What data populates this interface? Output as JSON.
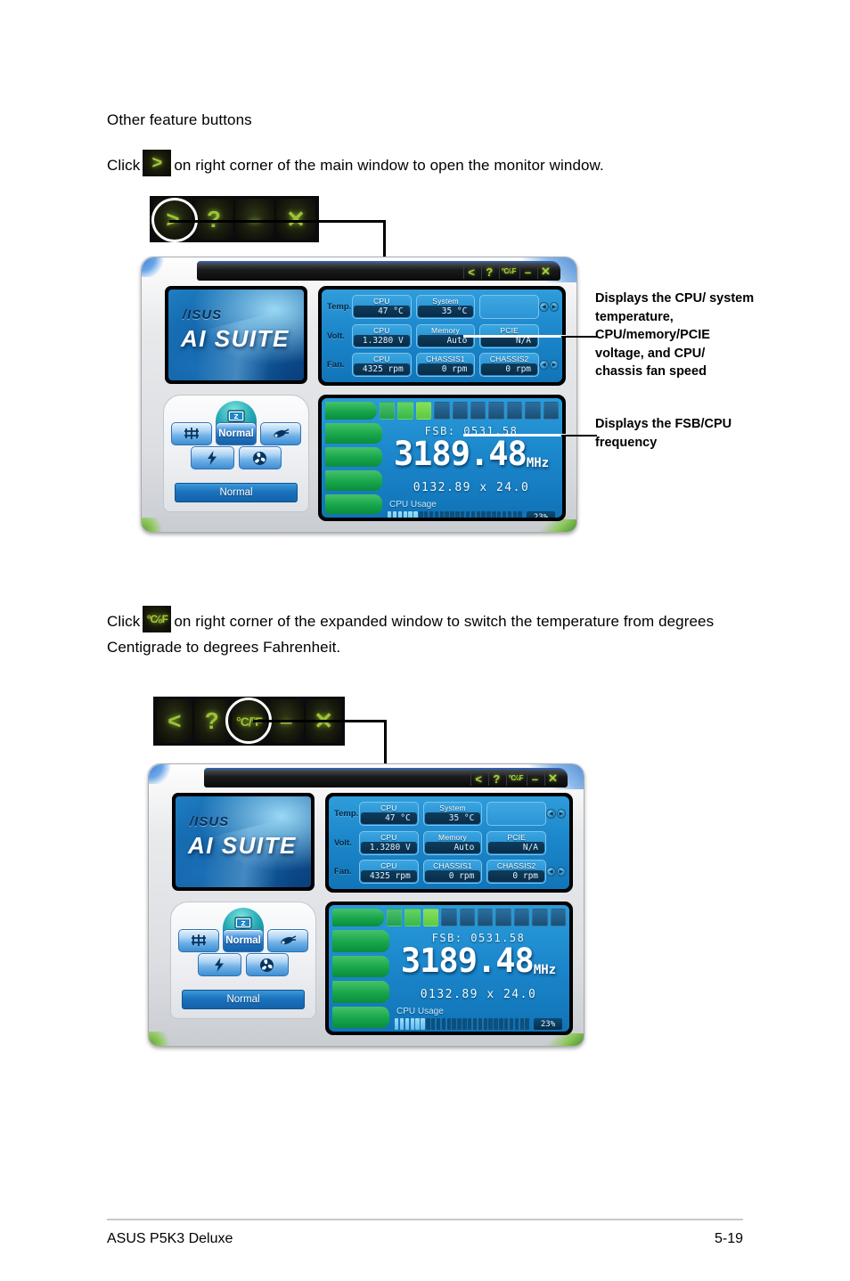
{
  "document": {
    "heading": "Other feature buttons",
    "paragraph_1_prefix": "Click",
    "paragraph_1_suffix": "on right corner of the main window to open the monitor window.",
    "paragraph_2_prefix": "Click",
    "paragraph_2_suffix": "on right corner of the expanded window to switch the temperature from degrees Centigrade to degrees Fahrenheit.",
    "inline_icon_1": "chevron-right-icon",
    "inline_icon_2": "celsius-fahrenheit-toggle-icon"
  },
  "footer": {
    "product": "ASUS P5K3 Deluxe",
    "page": "5-19",
    "rule_color": "#c9c9c9"
  },
  "toolbar_1": {
    "name": "main-window-corner-buttons",
    "buttons": [
      {
        "name": "expand-button",
        "glyph": ">",
        "highlighted": true
      },
      {
        "name": "help-button",
        "glyph": "?",
        "highlighted": false
      },
      {
        "name": "minimize-button",
        "glyph": "–",
        "highlighted": false
      },
      {
        "name": "close-button",
        "glyph": "✕",
        "highlighted": false
      }
    ],
    "accent_color": "#9ec236",
    "background_color": "#0a0b0c"
  },
  "toolbar_2": {
    "name": "expanded-window-corner-buttons",
    "buttons": [
      {
        "name": "collapse-button",
        "glyph": "<",
        "highlighted": false
      },
      {
        "name": "help-button",
        "glyph": "?",
        "highlighted": false
      },
      {
        "name": "temperature-unit-toggle-button",
        "glyph": "°C/°F",
        "highlighted": true
      },
      {
        "name": "minimize-button",
        "glyph": "–",
        "highlighted": false
      },
      {
        "name": "close-button",
        "glyph": "✕",
        "highlighted": false
      }
    ],
    "accent_color": "#9ec236",
    "background_color": "#0a0b0c"
  },
  "callouts": {
    "sensors": "Displays the CPU/ system temperature, CPU/memory/PCIE voltage, and CPU/ chassis fan speed",
    "frequency": "Displays the FSB/CPU frequency"
  },
  "app": {
    "logo_brand": "/ISUS",
    "logo_title": "AI SUITE",
    "titlebar_buttons": [
      {
        "name": "collapse-button",
        "glyph": "<"
      },
      {
        "name": "help-button",
        "glyph": "?"
      },
      {
        "name": "temperature-unit-toggle-button",
        "glyph": "°C⁄₀F"
      },
      {
        "name": "minimize-button",
        "glyph": "–"
      },
      {
        "name": "close-button",
        "glyph": "✕"
      }
    ],
    "control_panel": {
      "dome_icon": "monitor-sleep-icon",
      "row1": [
        {
          "name": "ai-gear-button",
          "label": "⎇",
          "icon": "gear-shift-icon",
          "active": false
        },
        {
          "name": "mode-normal-button",
          "label": "Normal",
          "icon": "",
          "active": true
        },
        {
          "name": "ai-booster-button",
          "label": "✎",
          "icon": "rocket-icon",
          "active": false
        }
      ],
      "row2": [
        {
          "name": "ai-power-button",
          "label": "⚡",
          "icon": "lightning-bolt-icon",
          "active": false
        },
        {
          "name": "ai-fan-button",
          "label": "✹",
          "icon": "fan-icon",
          "active": false
        }
      ],
      "status_label": "Normal"
    },
    "sensors": {
      "rows": [
        {
          "name": "temperature-row",
          "label": "Temp.",
          "has_nav": true,
          "cells": [
            {
              "name": "cpu-temperature-cell",
              "title": "CPU",
              "value": "47  °C"
            },
            {
              "name": "system-temperature-cell",
              "title": "System",
              "value": "35  °C"
            },
            {
              "name": "empty-temperature-cell",
              "title": "",
              "value": ""
            }
          ]
        },
        {
          "name": "voltage-row",
          "label": "Volt.",
          "has_nav": false,
          "cells": [
            {
              "name": "cpu-voltage-cell",
              "title": "CPU",
              "value": "1.3280  V"
            },
            {
              "name": "memory-voltage-cell",
              "title": "Memory",
              "value": "Auto"
            },
            {
              "name": "pcie-voltage-cell",
              "title": "PCIE",
              "value": "N/A"
            }
          ]
        },
        {
          "name": "fan-row",
          "label": "Fan.",
          "has_nav": true,
          "cells": [
            {
              "name": "cpu-fan-cell",
              "title": "CPU",
              "value": "4325  rpm"
            },
            {
              "name": "chassis1-fan-cell",
              "title": "CHASSIS1",
              "value": "0  rpm"
            },
            {
              "name": "chassis2-fan-cell",
              "title": "CHASSIS2",
              "value": "0  rpm"
            }
          ]
        }
      ]
    },
    "frequency": {
      "fsb_label": "FSB:  0531.58",
      "cpu_frequency": "3189.48",
      "cpu_frequency_unit": "MHz",
      "multiplier_line": "0132.89  x  24.0",
      "cpu_usage_label": "CPU Usage",
      "cpu_usage_percent": "23%",
      "cpu_usage_value": 23,
      "top_bar_lit_segments": 3,
      "top_bar_total_segments": 10
    }
  }
}
